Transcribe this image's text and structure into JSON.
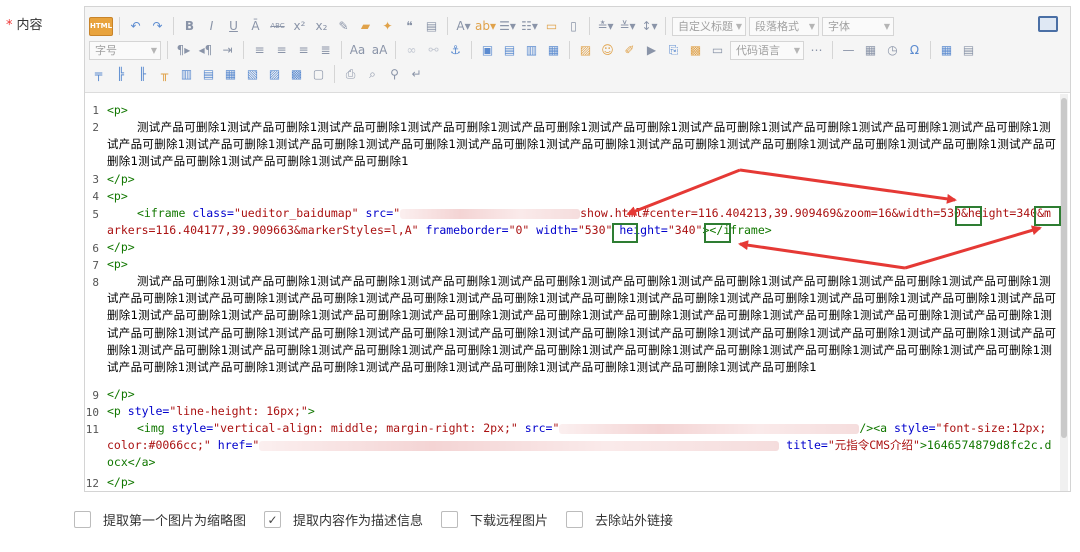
{
  "field": {
    "required_mark": "*",
    "label": "内容"
  },
  "toolbar": {
    "html_button": "HTML",
    "select_custom_title": "自定义标题",
    "select_paragraph": "段落格式",
    "select_font_family": "字体",
    "select_font_size": "字号",
    "select_code_language": "代码语言"
  },
  "code": {
    "line_numbers": [
      "1",
      "2",
      "3",
      "4",
      "5",
      "6",
      "7",
      "8",
      "9",
      "10",
      "11",
      "12"
    ],
    "p_open": "<p>",
    "p_close": "</p>",
    "text_short": "测试产品可删除1测试产品可删除1测试产品可删除1测试产品可删除1测试产品可删除1测试产品可删除1测试产品可删除1测试产品可删除1测试产品可删除1测试产品可删除1测试产品可删除1测试产品可删除1测试产品可删除1测试产品可删除1测试产品可删除1测试产品可删除1测试产品可删除1测试产品可删除1测试产品可删除1测试产品可删除1测试产品可删除1测试产品可删除1测试产品可删除1测试产品可删除1",
    "text_long": "测试产品可删除1测试产品可删除1测试产品可删除1测试产品可删除1测试产品可删除1测试产品可删除1测试产品可删除1测试产品可删除1测试产品可删除1测试产品可删除1测试产品可删除1测试产品可删除1测试产品可删除1测试产品可删除1测试产品可删除1测试产品可删除1测试产品可删除1测试产品可删除1测试产品可删除1测试产品可删除1测试产品可删除1测试产品可删除1测试产品可删除1测试产品可删除1测试产品可删除1测试产品可删除1测试产品可删除1测试产品可删除1测试产品可删除1测试产品可删除1测试产品可删除1测试产品可删除1测试产品可删除1测试产品可删除1测试产品可删除1测试产品可删除1测试产品可删除1测试产品可删除1测试产品可删除1测试产品可删除1测试产品可删除1测试产品可删除1测试产品可删除1测试产品可删除1测试产品可删除1测试产品可删除1测试产品可删除1测试产品可删除1测试产品可删除1测试产品可删除1测试产品可删除1测试产品可删除1测试产品可删除1测试产品可删除1测试产品可删除1测试产品可删除1测试产品可删除1测试产品可删除1测试产品可删除1测试产品可删除1",
    "iframe": {
      "open": "<iframe",
      "class_attr": " class=",
      "class_val": "\"ueditor_baidumap\"",
      "src_attr": " src=",
      "src_quote": "\"",
      "src_visible": "show.html#center=116.404213,39.909469&zoom=16&width=",
      "width_val": "530",
      "height_sep": "&height=",
      "height_val": "340",
      "src_tail": "&markers=116.404177,39.909663&markerStyles=l,A\"",
      "frameborder_attr": " frameborder=",
      "frameborder_val": "\"0\"",
      "width_attr": " width=",
      "width_attr_val": "\"530\"",
      "height_attr": " height=",
      "height_attr_val": "\"340\"",
      "close": "></iframe>"
    },
    "p10_open": "<p",
    "p10_style_attr": " style=",
    "p10_style_val": "\"line-height: 16px;\"",
    "p10_gt": ">",
    "img": {
      "open": "<img",
      "style_attr": " style=",
      "style_val": "\"vertical-align: middle; margin-right: 2px;\"",
      "src_attr": " src=",
      "src_quote": "\"",
      "close": "/><a",
      "a_style_attr": " style=",
      "a_style_val": "\"font-size:12px; color:#0066cc;\"",
      "href_attr": " href=",
      "href_quote": "\"",
      "title_attr": " title=",
      "title_val": "\"元指令CMS介绍\"",
      "link_text": ">1646574879d8fc2c.docx</a>"
    }
  },
  "options": [
    {
      "label": "提取第一个图片为缩略图",
      "checked": false
    },
    {
      "label": "提取内容作为描述信息",
      "checked": true
    },
    {
      "label": "下载远程图片",
      "checked": false
    },
    {
      "label": "去除站外链接",
      "checked": false
    }
  ],
  "colors": {
    "highlight_box": "#2e7d32",
    "arrow": "#e53935",
    "html_button": "#e8a33d"
  }
}
